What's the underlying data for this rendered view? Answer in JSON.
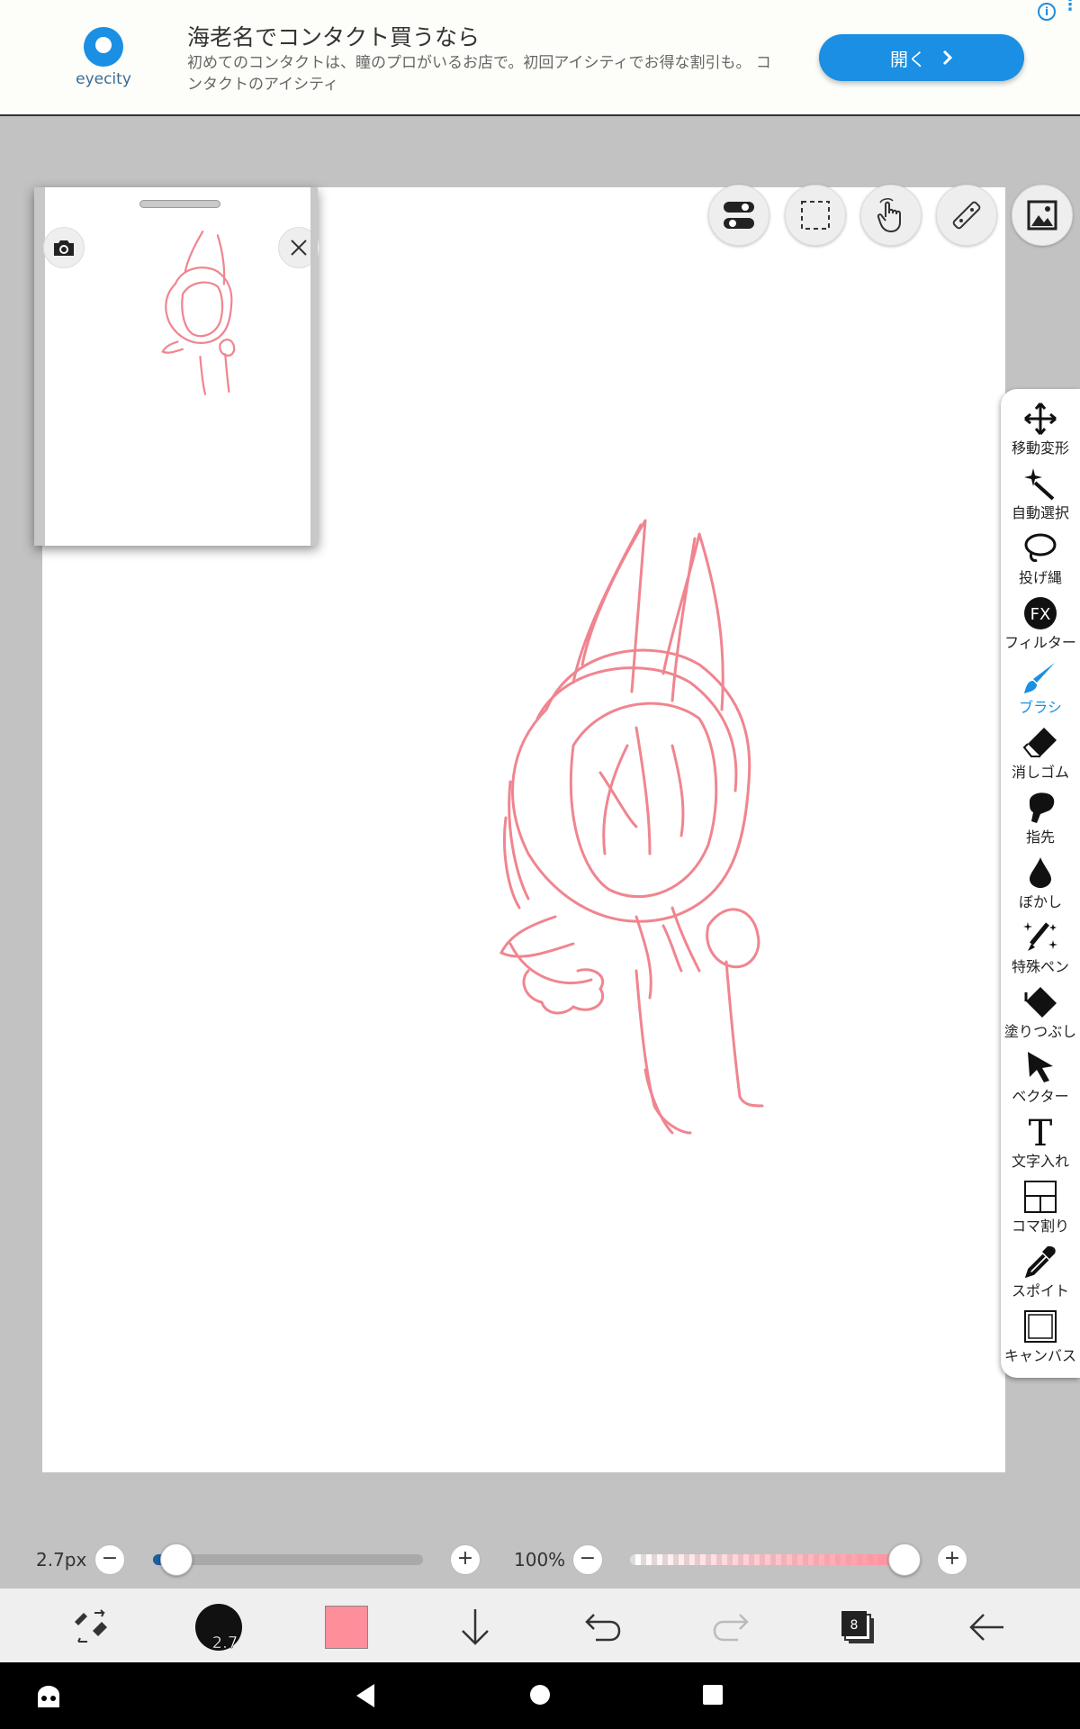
{
  "ad": {
    "logo_text": "eyecity",
    "title": "海老名でコンタクト買うなら",
    "description": "初めてのコンタクトは、瞳のプロがいるお店で。初回アイシティでお得な割引も。 コンタクトのアイシティ",
    "open_button": "開く",
    "info_icon": "i",
    "brand_color": "#1a8fe3"
  },
  "top_tools": [
    {
      "name": "toggle-icon"
    },
    {
      "name": "selection-icon"
    },
    {
      "name": "hand-icon"
    },
    {
      "name": "ruler-icon"
    },
    {
      "name": "image-icon"
    }
  ],
  "toolbar": {
    "items": [
      {
        "label": "移動変形",
        "icon": "move-icon"
      },
      {
        "label": "自動選択",
        "icon": "magic-wand-icon"
      },
      {
        "label": "投げ縄",
        "icon": "lasso-icon"
      },
      {
        "label": "フィルター",
        "icon": "filter-icon",
        "icon_text": "FX"
      },
      {
        "label": "ブラシ",
        "icon": "brush-icon",
        "active": true
      },
      {
        "label": "消しゴム",
        "icon": "eraser-icon"
      },
      {
        "label": "指先",
        "icon": "finger-icon"
      },
      {
        "label": "ぼかし",
        "icon": "blur-icon"
      },
      {
        "label": "特殊ペン",
        "icon": "special-pen-icon"
      },
      {
        "label": "塗りつぶし",
        "icon": "fill-icon"
      },
      {
        "label": "ベクター",
        "icon": "vector-icon"
      },
      {
        "label": "文字入れ",
        "icon": "text-icon",
        "icon_text": "T"
      },
      {
        "label": "コマ割り",
        "icon": "frame-divider-icon"
      },
      {
        "label": "スポイト",
        "icon": "eyedropper-icon"
      },
      {
        "label": "キャンバス",
        "icon": "canvas-icon"
      }
    ],
    "active_color": "#1a8fe3"
  },
  "brush_size": {
    "label": "2.7px",
    "value": 2.7,
    "min_label": "−",
    "plus_label": "+"
  },
  "opacity": {
    "label": "100%",
    "value": 100,
    "min_label": "−",
    "plus_label": "+"
  },
  "bottom": {
    "brush_size_badge": "2.7",
    "color_swatch": "#ff8e9b",
    "layer_count": "8"
  },
  "sketch_color": "#f0858f"
}
